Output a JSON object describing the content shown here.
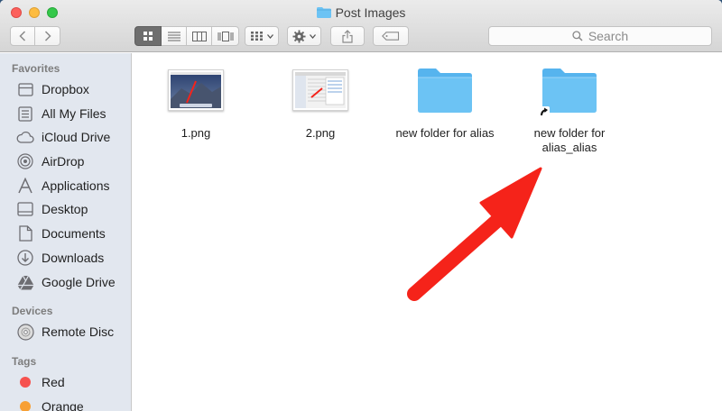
{
  "window": {
    "title": "Post Images"
  },
  "toolbar": {
    "back": "back",
    "forward": "forward",
    "search_label": "Search"
  },
  "sidebar": {
    "favorites_head": "Favorites",
    "favorites": [
      {
        "label": "Dropbox",
        "icon": "dropbox-icon"
      },
      {
        "label": "All My Files",
        "icon": "all-files-icon"
      },
      {
        "label": "iCloud Drive",
        "icon": "cloud-icon"
      },
      {
        "label": "AirDrop",
        "icon": "airdrop-icon"
      },
      {
        "label": "Applications",
        "icon": "applications-icon"
      },
      {
        "label": "Desktop",
        "icon": "desktop-icon"
      },
      {
        "label": "Documents",
        "icon": "documents-icon"
      },
      {
        "label": "Downloads",
        "icon": "downloads-icon"
      },
      {
        "label": "Google Drive",
        "icon": "google-drive-icon"
      }
    ],
    "devices_head": "Devices",
    "devices": [
      {
        "label": "Remote Disc",
        "icon": "disc-icon"
      }
    ],
    "tags_head": "Tags",
    "tags": [
      {
        "label": "Red",
        "color": "#f6524f"
      },
      {
        "label": "Orange",
        "color": "#f7a035"
      }
    ]
  },
  "files": [
    {
      "name": "1.png",
      "kind": "image"
    },
    {
      "name": "2.png",
      "kind": "image"
    },
    {
      "name": "new folder for alias",
      "kind": "folder"
    },
    {
      "name_line1": "new folder for",
      "name_line2": "alias_alias",
      "kind": "alias-folder"
    }
  ],
  "colors": {
    "folder": "#6cc3f4",
    "annotation_arrow": "#f5231a",
    "sidebar_bg": "#e1e6ee"
  }
}
